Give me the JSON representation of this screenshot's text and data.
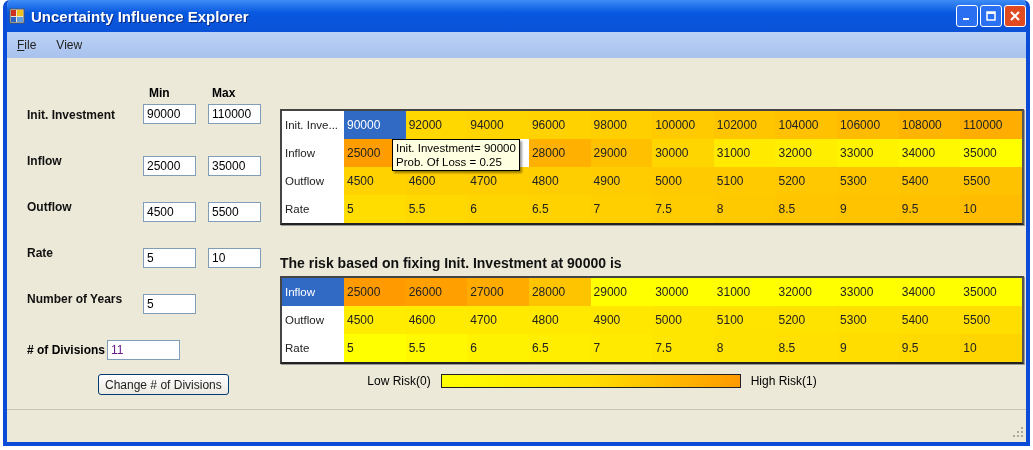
{
  "window": {
    "title": "Uncertainty Influence Explorer"
  },
  "menu": [
    {
      "label": "File"
    },
    {
      "label": "View"
    }
  ],
  "inputs": {
    "column_headers": [
      "Min",
      "Max"
    ],
    "rows": [
      {
        "label": "Init. Investment",
        "values": [
          "90000",
          "110000"
        ]
      },
      {
        "label": "Inflow",
        "values": [
          "25000",
          "35000"
        ]
      },
      {
        "label": "Outflow",
        "values": [
          "4500",
          "5500"
        ]
      },
      {
        "label": "Rate",
        "values": [
          "5",
          "10"
        ]
      },
      {
        "label": "Number of Years",
        "values": [
          "5"
        ]
      }
    ],
    "divisions": {
      "label": "# of Divisions",
      "value": "11"
    },
    "button": "Change # of Divisions"
  },
  "grid": {
    "rows": [
      {
        "header": {
          "text": "Init. Inve...",
          "selected": false
        },
        "cells": [
          {
            "text": "90000",
            "selected": true
          },
          {
            "text": "92000",
            "color": "#ffd800",
            "selected": false
          },
          {
            "text": "94000",
            "color": "#ffd500",
            "selected": false
          },
          {
            "text": "96000",
            "color": "#ffd200",
            "selected": false
          },
          {
            "text": "98000",
            "color": "#ffcf00",
            "selected": false
          },
          {
            "text": "100000",
            "color": "#ffcb00",
            "selected": false
          },
          {
            "text": "102000",
            "color": "#ffc600",
            "selected": false
          },
          {
            "text": "104000",
            "color": "#ffc100",
            "selected": false
          },
          {
            "text": "106000",
            "color": "#ffbb00",
            "selected": false
          },
          {
            "text": "108000",
            "color": "#ffb500",
            "selected": false
          },
          {
            "text": "110000",
            "color": "#ffad00",
            "selected": false
          }
        ]
      },
      {
        "header": {
          "text": "Inflow",
          "selected": false
        },
        "cells": [
          {
            "text": "25000",
            "color": "#ff9c00",
            "selected": false
          },
          null,
          null,
          {
            "text": "28000",
            "color": "#ffb000",
            "selected": false
          },
          {
            "text": "29000",
            "color": "#ffc000",
            "selected": false
          },
          {
            "text": "30000",
            "color": "#ffd500",
            "selected": false
          },
          {
            "text": "31000",
            "color": "#ffea00",
            "selected": false
          },
          {
            "text": "32000",
            "color": "#ffee00",
            "selected": false
          },
          {
            "text": "33000",
            "color": "#fff300",
            "selected": false
          },
          {
            "text": "34000",
            "color": "#fff800",
            "selected": false
          },
          {
            "text": "35000",
            "color": "#ffff00",
            "selected": false
          }
        ]
      },
      {
        "header": {
          "text": "Outflow",
          "selected": false
        },
        "cells": [
          {
            "text": "4500",
            "color": "#ffd200",
            "selected": false
          },
          {
            "text": "4600",
            "color": "#ffd000",
            "selected": false
          },
          {
            "text": "4700",
            "color": "#ffcf00",
            "selected": false
          },
          {
            "text": "4800",
            "color": "#ffce00",
            "selected": false
          },
          {
            "text": "4900",
            "color": "#ffcc00",
            "selected": false
          },
          {
            "text": "5000",
            "color": "#ffcb00",
            "selected": false
          },
          {
            "text": "5100",
            "color": "#ffca00",
            "selected": false
          },
          {
            "text": "5200",
            "color": "#ffc800",
            "selected": false
          },
          {
            "text": "5300",
            "color": "#ffc600",
            "selected": false
          },
          {
            "text": "5400",
            "color": "#ffc400",
            "selected": false
          },
          {
            "text": "5500",
            "color": "#ffc200",
            "selected": false
          }
        ]
      },
      {
        "header": {
          "text": "Rate",
          "selected": false
        },
        "cells": [
          {
            "text": "5",
            "color": "#ffdd00",
            "selected": false
          },
          {
            "text": "5.5",
            "color": "#ffd800",
            "selected": false
          },
          {
            "text": "6",
            "color": "#ffd500",
            "selected": false
          },
          {
            "text": "6.5",
            "color": "#ffd200",
            "selected": false
          },
          {
            "text": "7",
            "color": "#ffcf00",
            "selected": false
          },
          {
            "text": "7.5",
            "color": "#ffcc00",
            "selected": false
          },
          {
            "text": "8",
            "color": "#ffc900",
            "selected": false
          },
          {
            "text": "8.5",
            "color": "#ffc600",
            "selected": false
          },
          {
            "text": "9",
            "color": "#ffc300",
            "selected": false
          },
          {
            "text": "9.5",
            "color": "#ffc000",
            "selected": false
          },
          {
            "text": "10",
            "color": "#ffbc00",
            "selected": false
          }
        ]
      }
    ]
  },
  "tooltip": {
    "lines": [
      "Init. Investment= 90000",
      "Prob. Of Loss = 0.25"
    ]
  },
  "fixed_heading": "The risk based on fixing Init. Investment at 90000 is",
  "fixed_grid": {
    "rows": [
      {
        "header": {
          "text": "Inflow",
          "selected": true
        },
        "cells": [
          {
            "text": "25000",
            "color": "#ff9a00",
            "selected": false
          },
          {
            "text": "26000",
            "color": "#ff9f00",
            "selected": false
          },
          {
            "text": "27000",
            "color": "#ffab00",
            "selected": false
          },
          {
            "text": "28000",
            "color": "#ffc400",
            "selected": false
          },
          {
            "text": "29000",
            "color": "#ffff00",
            "selected": false
          },
          {
            "text": "30000",
            "color": "#ffff00",
            "selected": false
          },
          {
            "text": "31000",
            "color": "#ffff00",
            "selected": false
          },
          {
            "text": "32000",
            "color": "#ffff00",
            "selected": false
          },
          {
            "text": "33000",
            "color": "#ffff00",
            "selected": false
          },
          {
            "text": "34000",
            "color": "#ffff00",
            "selected": false
          },
          {
            "text": "35000",
            "color": "#ffff00",
            "selected": false
          }
        ]
      },
      {
        "header": {
          "text": "Outflow",
          "selected": false
        },
        "cells": [
          {
            "text": "4500",
            "color": "#ffec00",
            "selected": false
          },
          {
            "text": "4600",
            "color": "#ffeb00",
            "selected": false
          },
          {
            "text": "4700",
            "color": "#ffea00",
            "selected": false
          },
          {
            "text": "4800",
            "color": "#ffe900",
            "selected": false
          },
          {
            "text": "4900",
            "color": "#ffe700",
            "selected": false
          },
          {
            "text": "5000",
            "color": "#ffe600",
            "selected": false
          },
          {
            "text": "5100",
            "color": "#ffe400",
            "selected": false
          },
          {
            "text": "5200",
            "color": "#ffe300",
            "selected": false
          },
          {
            "text": "5300",
            "color": "#ffe100",
            "selected": false
          },
          {
            "text": "5400",
            "color": "#ffe000",
            "selected": false
          },
          {
            "text": "5500",
            "color": "#ffde00",
            "selected": false
          }
        ]
      },
      {
        "header": {
          "text": "Rate",
          "selected": false
        },
        "cells": [
          {
            "text": "5",
            "color": "#ffff00",
            "selected": false
          },
          {
            "text": "5.5",
            "color": "#fff800",
            "selected": false
          },
          {
            "text": "6",
            "color": "#fff200",
            "selected": false
          },
          {
            "text": "6.5",
            "color": "#ffee00",
            "selected": false
          },
          {
            "text": "7",
            "color": "#ffea00",
            "selected": false
          },
          {
            "text": "7.5",
            "color": "#ffe600",
            "selected": false
          },
          {
            "text": "8",
            "color": "#ffe300",
            "selected": false
          },
          {
            "text": "8.5",
            "color": "#ffe000",
            "selected": false
          },
          {
            "text": "9",
            "color": "#ffdd00",
            "selected": false
          },
          {
            "text": "9.5",
            "color": "#ffda00",
            "selected": false
          },
          {
            "text": "10",
            "color": "#ffd500",
            "selected": false
          }
        ]
      }
    ]
  },
  "legend": {
    "low": "Low Risk(0)",
    "high": "High Risk(1)"
  }
}
